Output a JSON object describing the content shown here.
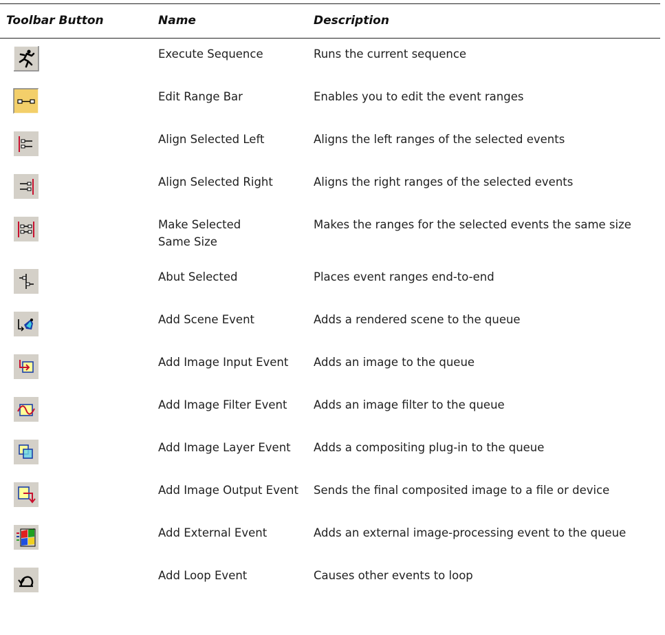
{
  "headers": {
    "toolbar_button": "Toolbar Button",
    "name": "Name",
    "description": "Description"
  },
  "rows": [
    {
      "icon": "execute-sequence-icon",
      "name": "Execute Sequence",
      "description": "Runs the current sequence"
    },
    {
      "icon": "edit-range-bar-icon",
      "name": "Edit Range Bar",
      "description": "Enables you to edit the event ranges"
    },
    {
      "icon": "align-selected-left-icon",
      "name": "Align Selected Left",
      "description": "Aligns the left ranges of the selected events"
    },
    {
      "icon": "align-selected-right-icon",
      "name": "Align Selected Right",
      "description": "Aligns the right ranges of the selected events"
    },
    {
      "icon": "make-selected-same-size-icon",
      "name_line1": "Make Selected",
      "name_line2": "Same Size",
      "description": "Makes the ranges for the selected events the same size"
    },
    {
      "icon": "abut-selected-icon",
      "name": "Abut Selected",
      "description": "Places event ranges end-to-end"
    },
    {
      "icon": "add-scene-event-icon",
      "name": "Add Scene Event",
      "description": "Adds a rendered scene to the queue"
    },
    {
      "icon": "add-image-input-event-icon",
      "name": "Add Image Input Event",
      "description": "Adds an image to the queue"
    },
    {
      "icon": "add-image-filter-event-icon",
      "name": "Add Image Filter Event",
      "description": "Adds an image filter to the queue"
    },
    {
      "icon": "add-image-layer-event-icon",
      "name": "Add Image Layer Event",
      "description": "Adds a compositing plug-in to the queue"
    },
    {
      "icon": "add-image-output-event-icon",
      "name": "Add Image Output Event",
      "description": "Sends the final composited image to a file or device"
    },
    {
      "icon": "add-external-event-icon",
      "name": "Add External Event",
      "description": "Adds an external image-processing event to the queue"
    },
    {
      "icon": "add-loop-event-icon",
      "name": "Add Loop Event",
      "description": "Causes other events to loop"
    }
  ],
  "colors": {
    "button_face": "#d4d0c8",
    "highlight_yellow": "#f3cf6a",
    "red_line": "#c8102e",
    "blue": "#1a3fa8",
    "yellow_fill": "#ffff99"
  }
}
